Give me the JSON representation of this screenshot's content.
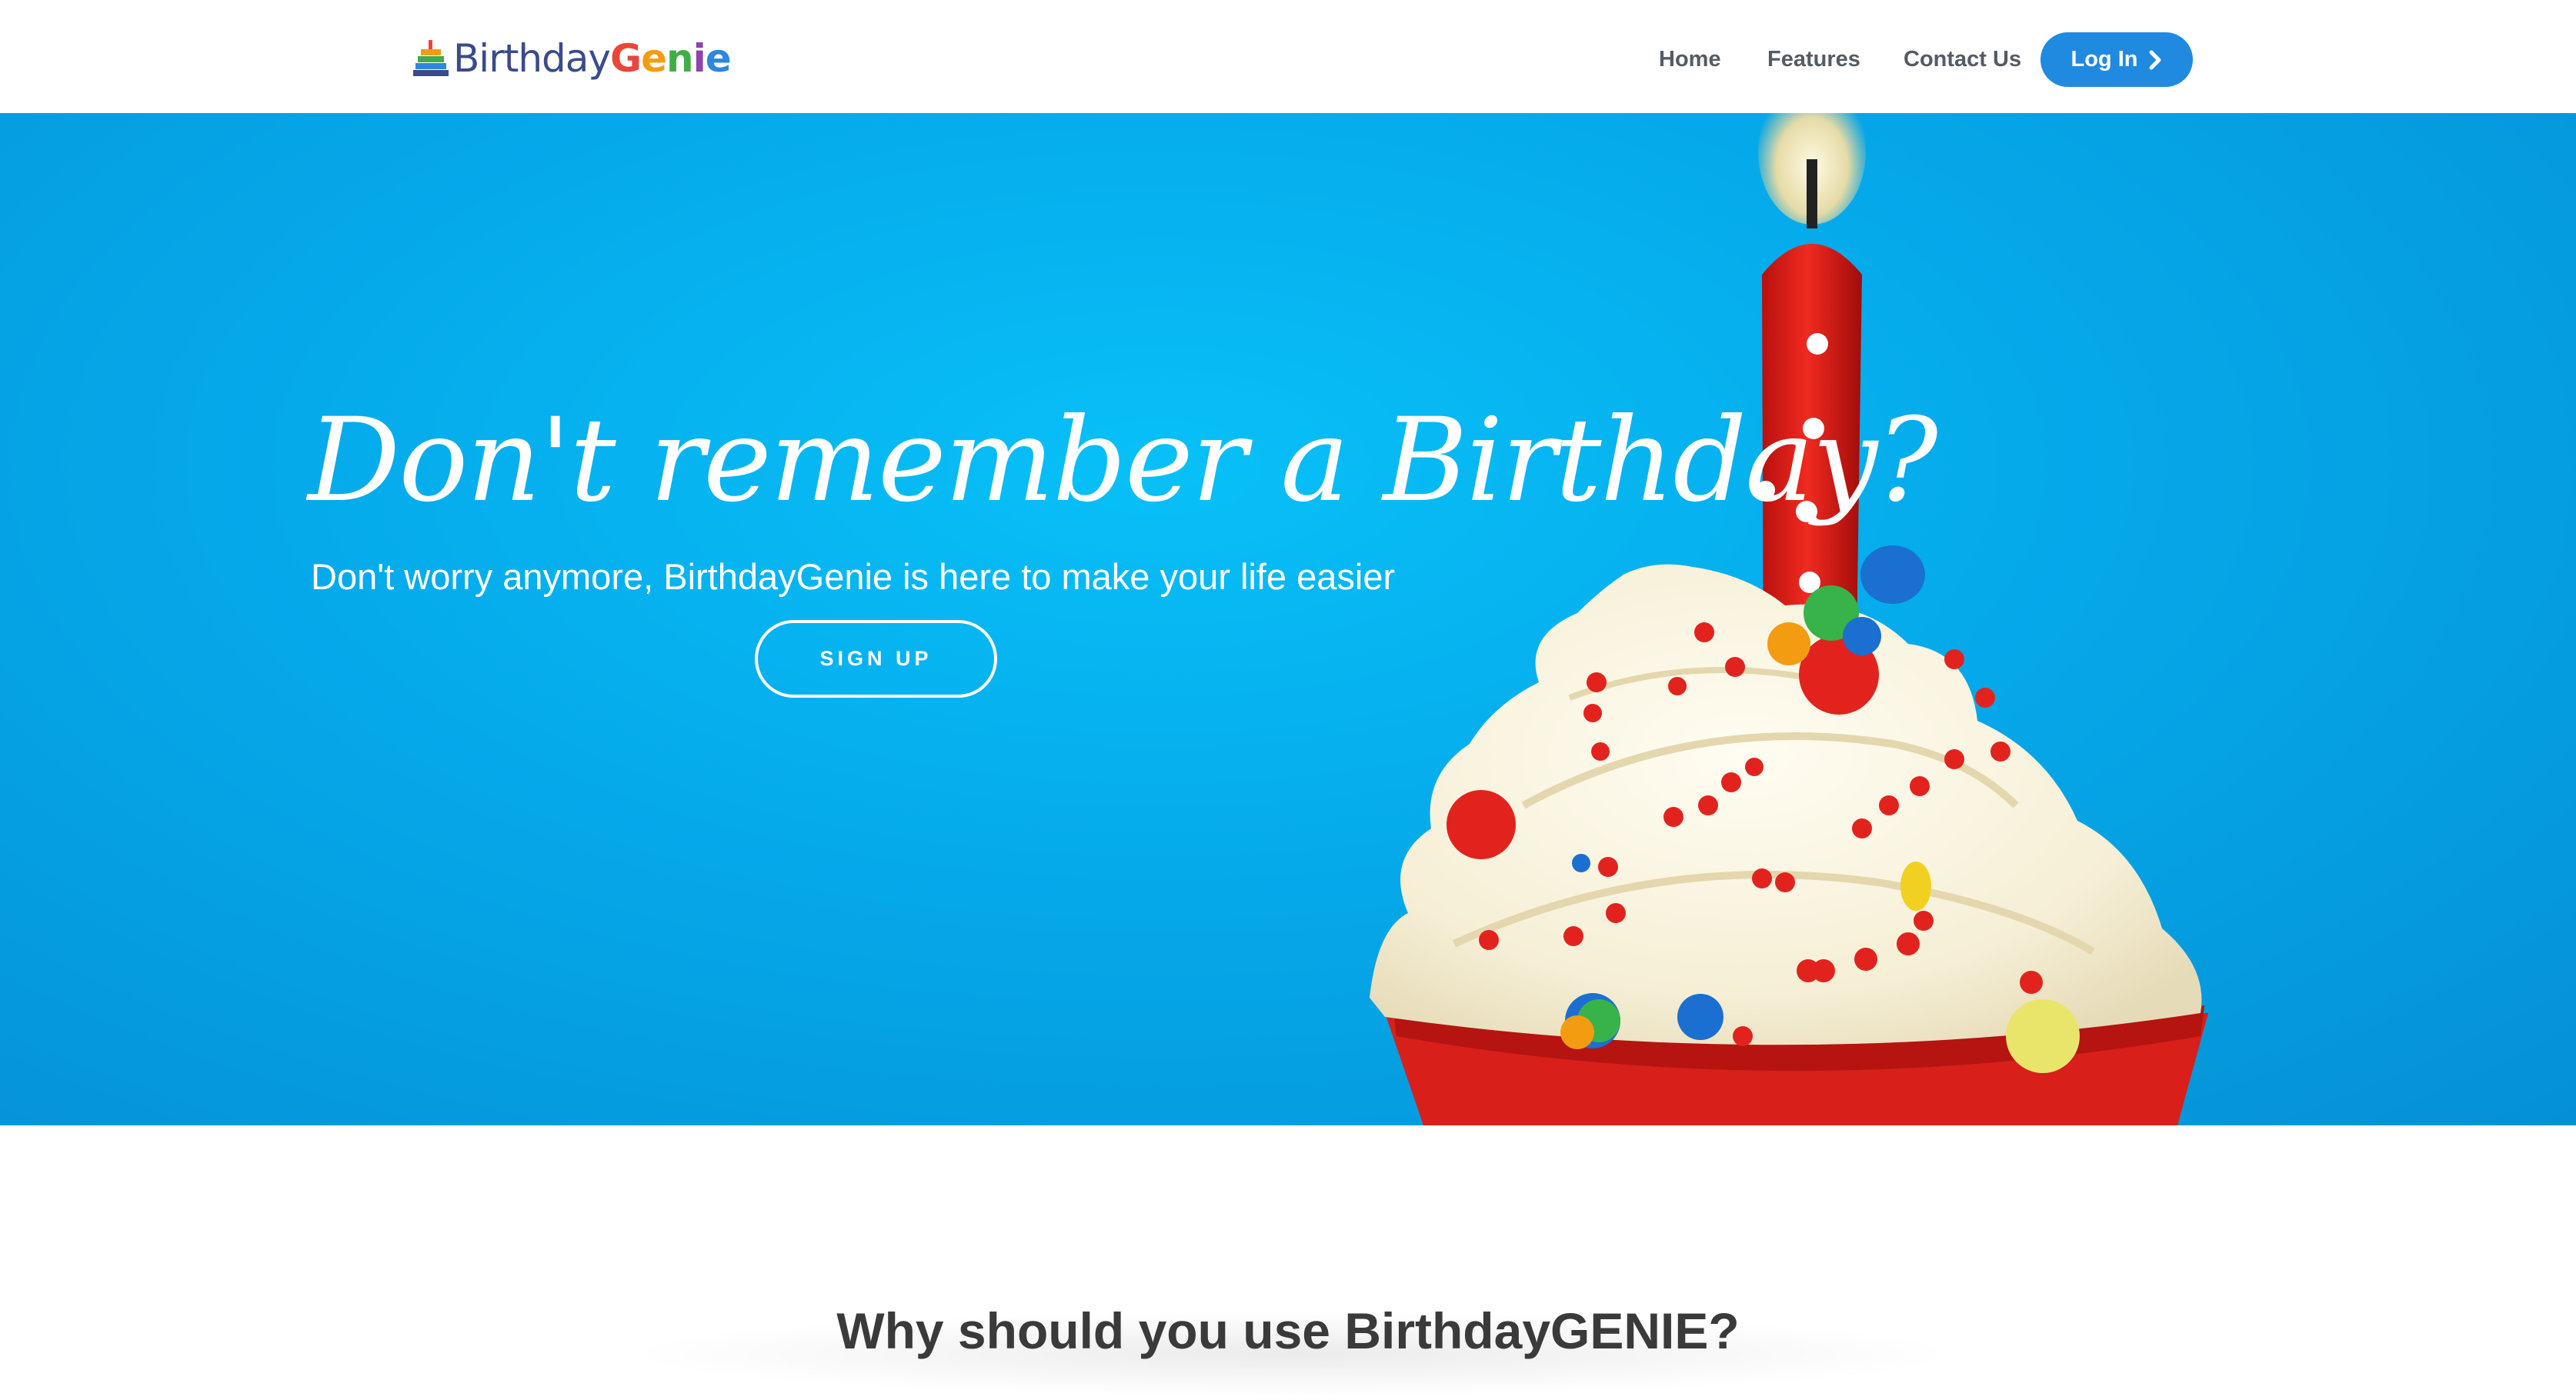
{
  "brand": {
    "name_part1": "Birthday",
    "name_part2_letters": [
      "G",
      "e",
      "n",
      "i",
      "e"
    ],
    "name_part2_colors": [
      "#e8463a",
      "#f39c12",
      "#3fae49",
      "#8e44ad",
      "#2e86de"
    ],
    "logo_icon": "birthday-cake-icon"
  },
  "nav": {
    "items": [
      {
        "label": "Home"
      },
      {
        "label": "Features"
      },
      {
        "label": "Contact Us"
      }
    ],
    "login_label": "Log In",
    "login_icon": "chevron-right-icon"
  },
  "hero": {
    "headline": "Don't remember a Birthday?",
    "subheadline": "Don't worry anymore, BirthdayGenie is here to make your life easier",
    "signup_label": "SIGN UP",
    "background_color": "#05a9ea"
  },
  "why": {
    "title": "Why should you use BirthdayGENIE?"
  },
  "colors": {
    "accent": "#1f8ae0",
    "nav_text": "#555b63"
  }
}
